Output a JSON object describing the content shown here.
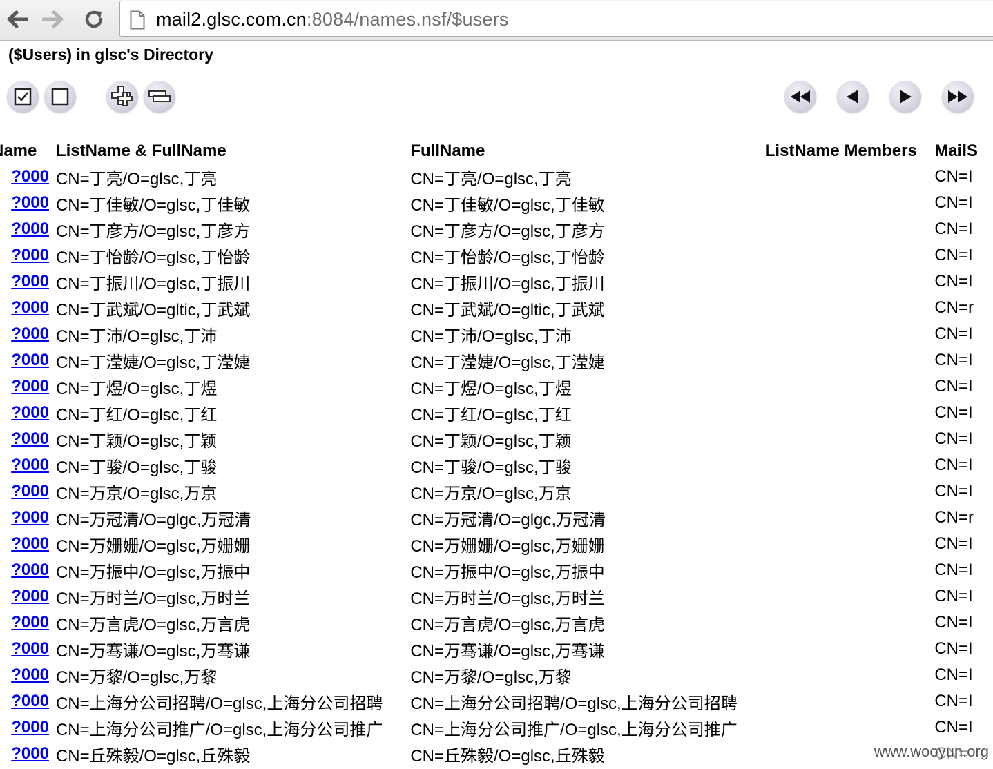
{
  "browser": {
    "url_host": "mail2.glsc.com.cn",
    "url_rest": ":8084/names.nsf/$users"
  },
  "page": {
    "title": "($Users) in glsc's Directory"
  },
  "toolbar": {
    "left_icons": [
      "select-all-icon",
      "deselect-all-icon",
      "expand-all-icon",
      "collapse-all-icon"
    ],
    "right_icons": [
      "first-page-icon",
      "previous-page-icon",
      "next-page-icon",
      "last-page-icon"
    ]
  },
  "table": {
    "columns": [
      "Name",
      "ListName & FullName",
      "FullName",
      "ListName Members",
      "MailS"
    ],
    "rows": [
      {
        "link": "?000",
        "listname": "CN=丁亮/O=glsc,丁亮",
        "fullname": "CN=丁亮/O=glsc,丁亮",
        "members": "",
        "mail": "CN=I"
      },
      {
        "link": "?000",
        "listname": "CN=丁佳敏/O=glsc,丁佳敏",
        "fullname": "CN=丁佳敏/O=glsc,丁佳敏",
        "members": "",
        "mail": "CN=I"
      },
      {
        "link": "?000",
        "listname": "CN=丁彦方/O=glsc,丁彦方",
        "fullname": "CN=丁彦方/O=glsc,丁彦方",
        "members": "",
        "mail": "CN=I"
      },
      {
        "link": "?000",
        "listname": "CN=丁怡龄/O=glsc,丁怡龄",
        "fullname": "CN=丁怡龄/O=glsc,丁怡龄",
        "members": "",
        "mail": "CN=I"
      },
      {
        "link": "?000",
        "listname": "CN=丁振川/O=glsc,丁振川",
        "fullname": "CN=丁振川/O=glsc,丁振川",
        "members": "",
        "mail": "CN=I"
      },
      {
        "link": "?000",
        "listname": "CN=丁武斌/O=gltic,丁武斌",
        "fullname": "CN=丁武斌/O=gltic,丁武斌",
        "members": "",
        "mail": "CN=r"
      },
      {
        "link": "?000",
        "listname": "CN=丁沛/O=glsc,丁沛",
        "fullname": "CN=丁沛/O=glsc,丁沛",
        "members": "",
        "mail": "CN=I"
      },
      {
        "link": "?000",
        "listname": "CN=丁滢婕/O=glsc,丁滢婕",
        "fullname": "CN=丁滢婕/O=glsc,丁滢婕",
        "members": "",
        "mail": "CN=I"
      },
      {
        "link": "?000",
        "listname": "CN=丁煜/O=glsc,丁煜",
        "fullname": "CN=丁煜/O=glsc,丁煜",
        "members": "",
        "mail": "CN=I"
      },
      {
        "link": "?000",
        "listname": "CN=丁红/O=glsc,丁红",
        "fullname": "CN=丁红/O=glsc,丁红",
        "members": "",
        "mail": "CN=I"
      },
      {
        "link": "?000",
        "listname": "CN=丁颖/O=glsc,丁颖",
        "fullname": "CN=丁颖/O=glsc,丁颖",
        "members": "",
        "mail": "CN=I"
      },
      {
        "link": "?000",
        "listname": "CN=丁骏/O=glsc,丁骏",
        "fullname": "CN=丁骏/O=glsc,丁骏",
        "members": "",
        "mail": "CN=I"
      },
      {
        "link": "?000",
        "listname": "CN=万京/O=glsc,万京",
        "fullname": "CN=万京/O=glsc,万京",
        "members": "",
        "mail": "CN=I"
      },
      {
        "link": "?000",
        "listname": "CN=万冠清/O=glgc,万冠清",
        "fullname": "CN=万冠清/O=glgc,万冠清",
        "members": "",
        "mail": "CN=r"
      },
      {
        "link": "?000",
        "listname": "CN=万姗姗/O=glsc,万姗姗",
        "fullname": "CN=万姗姗/O=glsc,万姗姗",
        "members": "",
        "mail": "CN=I"
      },
      {
        "link": "?000",
        "listname": "CN=万振中/O=glsc,万振中",
        "fullname": "CN=万振中/O=glsc,万振中",
        "members": "",
        "mail": "CN=I"
      },
      {
        "link": "?000",
        "listname": "CN=万时兰/O=glsc,万时兰",
        "fullname": "CN=万时兰/O=glsc,万时兰",
        "members": "",
        "mail": "CN=I"
      },
      {
        "link": "?000",
        "listname": "CN=万言虎/O=glsc,万言虎",
        "fullname": "CN=万言虎/O=glsc,万言虎",
        "members": "",
        "mail": "CN=I"
      },
      {
        "link": "?000",
        "listname": "CN=万骞谦/O=glsc,万骞谦",
        "fullname": "CN=万骞谦/O=glsc,万骞谦",
        "members": "",
        "mail": "CN=I"
      },
      {
        "link": "?000",
        "listname": "CN=万黎/O=glsc,万黎",
        "fullname": "CN=万黎/O=glsc,万黎",
        "members": "",
        "mail": "CN=I"
      },
      {
        "link": "?000",
        "listname": "CN=上海分公司招聘/O=glsc,上海分公司招聘",
        "fullname": "CN=上海分公司招聘/O=glsc,上海分公司招聘",
        "members": "",
        "mail": "CN=I"
      },
      {
        "link": "?000",
        "listname": "CN=上海分公司推广/O=glsc,上海分公司推广",
        "fullname": "CN=上海分公司推广/O=glsc,上海分公司推广",
        "members": "",
        "mail": "CN=I"
      },
      {
        "link": "?000",
        "listname": "CN=丘殊毅/O=glsc,丘殊毅",
        "fullname": "CN=丘殊毅/O=glsc,丘殊毅",
        "members": "",
        "mail": "CN="
      }
    ]
  },
  "watermark": "www.wooyun.org"
}
